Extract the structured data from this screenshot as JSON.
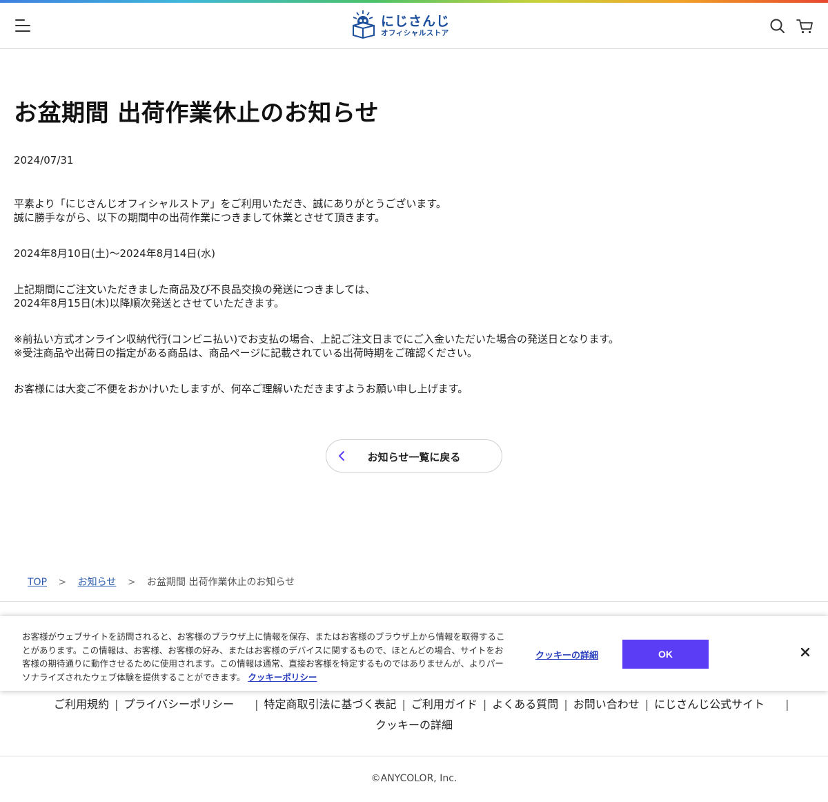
{
  "header": {
    "logo_main": "にじさんじ",
    "logo_sub": "オフィシャルストア",
    "brand_color": "#1c4f9c"
  },
  "article": {
    "title": "お盆期間 出荷作業休止のお知らせ",
    "date": "2024/07/31",
    "paragraphs": [
      [
        "平素より「にじさんじオフィシャルストア」をご利用いただき、誠にありがとうございます。",
        "誠に勝手ながら、以下の期間中の出荷作業につきまして休業とさせて頂きます。"
      ],
      [
        "2024年8月10日(土)〜2024年8月14日(水)"
      ],
      [
        "上記期間にご注文いただきました商品及び不良品交換の発送につきましては、",
        "2024年8月15日(木)以降順次発送とさせていただきます。"
      ],
      [
        "※前払い方式オンライン収納代行(コンビニ払い)でお支払の場合、上記ご注文日までにご入金いただいた場合の発送日となります。",
        "※受注商品や出荷日の指定がある商品は、商品ページに記載されている出荷時期をご確認ください。"
      ],
      [
        "お客様には大変ご不便をおかけいたしますが、何卒ご理解いただきますようお願い申し上げます。"
      ]
    ],
    "back_label": "お知らせ一覧に戻る"
  },
  "breadcrumb": {
    "items": [
      "TOP",
      "お知らせ"
    ],
    "current": "お盆期間 出荷作業休止のお知らせ",
    "separator": ">"
  },
  "cookie_banner": {
    "text": "お客様がウェブサイトを訪問されると、お客様のブラウザ上に情報を保存、またはお客様のブラウザ上から情報を取得することがあります。この情報は、お客様、お客様の好み、またはお客様のデバイスに関するもので、ほとんどの場合、サイトをお客様の期待通りに動作させるために使用されます。この情報は通常、直接お客様を特定するものではありませんが、よりパーソナライズされたウェブ体験を提供することができます。",
    "policy_link": "クッキーポリシー",
    "details_label": "クッキーの詳細",
    "ok_label": "OK",
    "accent_color": "#5b3df5"
  },
  "footer": {
    "links_row1": [
      "ご利用規約",
      "プライバシーポリシー",
      "特定商取引法に基づく表記",
      "ご利用ガイド",
      "よくある質問",
      "お問い合わせ",
      "にじさんじ公式サイト"
    ],
    "links_row2": [
      "クッキーの詳細"
    ],
    "copyright": "©ANYCOLOR, Inc."
  }
}
